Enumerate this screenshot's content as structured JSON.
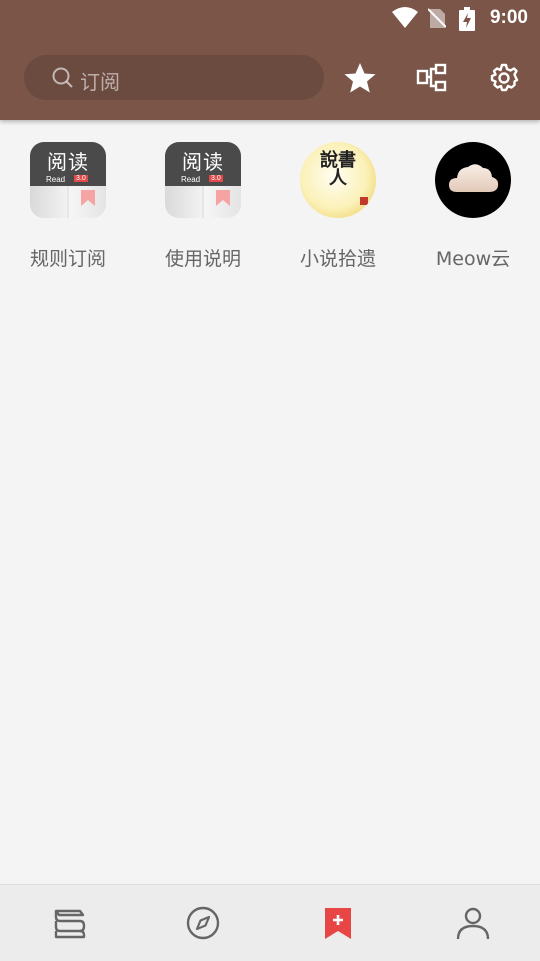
{
  "status_bar": {
    "time": "9:00",
    "icons": [
      "wifi-icon",
      "no-sim-icon",
      "battery-charging-icon"
    ]
  },
  "toolbar": {
    "search_placeholder": "订阅",
    "actions": [
      "star-icon",
      "rule-tree-icon",
      "gear-icon"
    ]
  },
  "subscriptions": [
    {
      "label": "规则订阅",
      "icon": "yuedu-book-icon",
      "title": "阅读",
      "sub": "Read",
      "version": "3.0"
    },
    {
      "label": "使用说明",
      "icon": "yuedu-book-icon",
      "title": "阅读",
      "sub": "Read",
      "version": "3.0"
    },
    {
      "label": "小说拾遗",
      "icon": "shuoshuren-icon",
      "title": "說書人"
    },
    {
      "label": "Meow云",
      "icon": "cloud-icon"
    }
  ],
  "bottom_nav": {
    "items": [
      "bookshelf-icon",
      "compass-icon",
      "bookmark-add-icon",
      "person-icon"
    ],
    "active_index": 2
  },
  "colors": {
    "appbar": "#7a5548",
    "active_nav": "#e84545",
    "inactive_nav": "#666666",
    "background": "#f4f4f4"
  }
}
